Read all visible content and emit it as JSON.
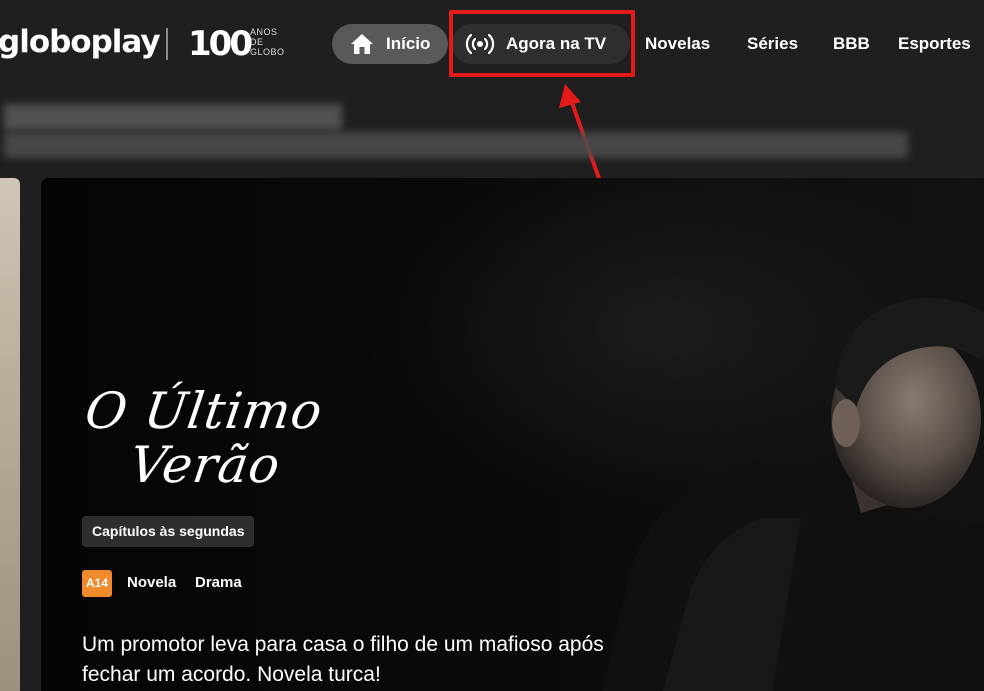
{
  "header": {
    "logo": "globoplay",
    "centenary": {
      "number": "100",
      "lines": [
        "ANOS",
        "DE",
        "GLOBO"
      ]
    },
    "nav": [
      {
        "label": "Início",
        "icon": "home-icon"
      },
      {
        "label": "Agora na TV",
        "icon": "broadcast-icon"
      },
      {
        "label": "Novelas"
      },
      {
        "label": "Séries"
      },
      {
        "label": "BBB"
      },
      {
        "label": "Esportes"
      }
    ]
  },
  "annotation": {
    "color": "#e31b1b",
    "target": "Agora na TV"
  },
  "hero": {
    "title_line1": "O Último",
    "title_line2": "Verão",
    "schedule": "Capítulos às segundas",
    "rating": "A14",
    "rating_color": "#f08a2a",
    "genres": [
      "Novela",
      "Drama"
    ],
    "synopsis": "Um promotor leva para casa o filho de um mafioso após fechar um acordo. Novela turca!"
  }
}
